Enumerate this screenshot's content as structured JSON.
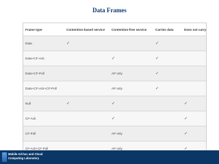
{
  "slide": {
    "title": "Data Frames"
  },
  "table": {
    "headers": [
      "Frame type",
      "Contention-based service",
      "Contention-free service",
      "Carries data",
      "Does not carry data"
    ],
    "rows": [
      [
        "Data",
        "✓",
        "",
        "✓",
        ""
      ],
      [
        "Data+CF-Ack",
        "",
        "✓",
        "✓",
        ""
      ],
      [
        "Data+CF-Poll",
        "",
        "AP only",
        "✓",
        ""
      ],
      [
        "Data+CF-Ack+CF-Poll",
        "",
        "AP only",
        "✓",
        ""
      ],
      [
        "Null",
        "✓",
        "✓",
        "",
        "✓"
      ],
      [
        "CF-Ack",
        "",
        "✓",
        "",
        "✓"
      ],
      [
        "CF-Poll",
        "",
        "AP only",
        "",
        "✓"
      ],
      [
        "CF-Ack+CF-Poll",
        "",
        "AP only",
        "",
        "✓"
      ]
    ]
  },
  "footer": {
    "line1": "Mobile Ad-hoc and Cloud",
    "line2": "Computing Laboratory"
  }
}
